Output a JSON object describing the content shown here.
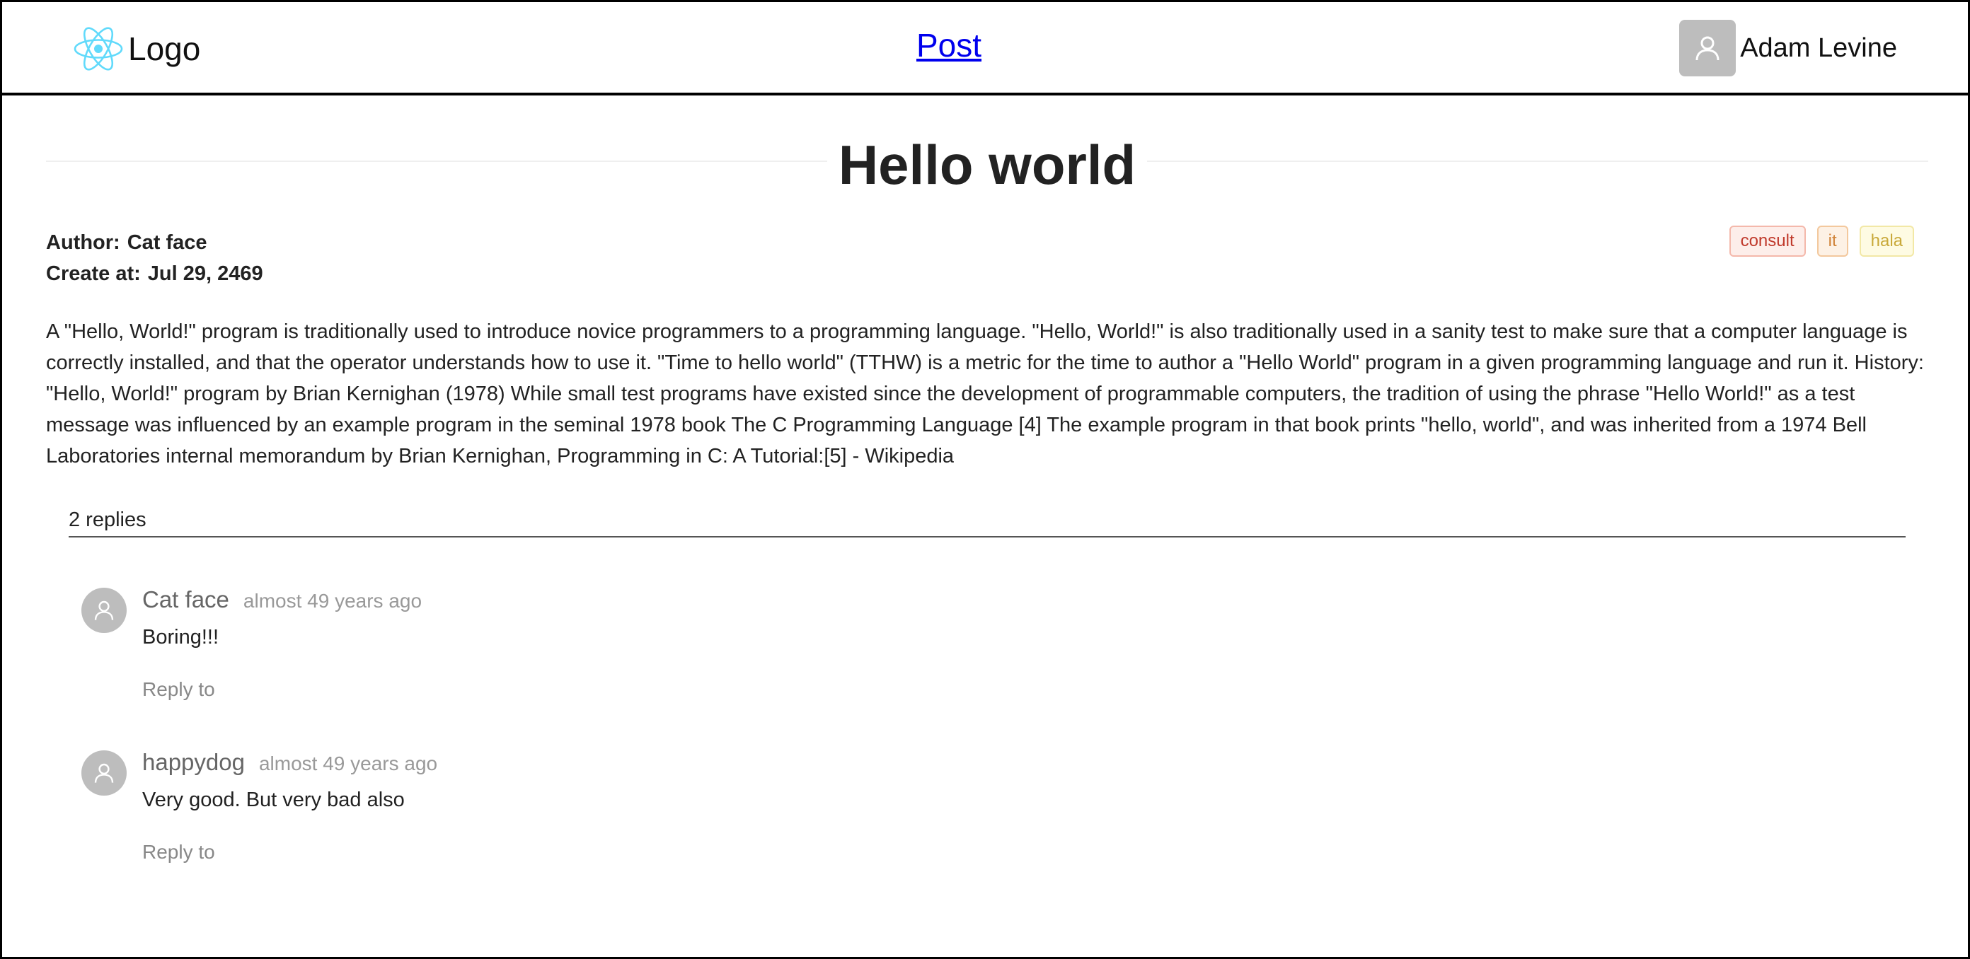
{
  "header": {
    "logo_text": "Logo",
    "nav_link": "Post",
    "user_name": "Adam Levine",
    "logo_color": "#61dafb"
  },
  "post": {
    "title": "Hello world",
    "author_label": "Author:",
    "author": "Cat face",
    "created_label": "Create at:",
    "created": "Jul 29, 2469",
    "tags": [
      {
        "label": "consult",
        "color": "#c0392b"
      },
      {
        "label": "it",
        "color": "#d1843a"
      },
      {
        "label": "hala",
        "color": "#c9a93a"
      }
    ],
    "content": "A \"Hello, World!\" program is traditionally used to introduce novice programmers to a programming language. \"Hello, World!\" is also traditionally used in a sanity test to make sure that a computer language is correctly installed, and that the operator understands how to use it. \"Time to hello world\" (TTHW) is a metric for the time to author a \"Hello World\" program in a given programming language and run it. History: \"Hello, World!\" program by Brian Kernighan (1978) While small test programs have existed since the development of programmable computers, the tradition of using the phrase \"Hello World!\" as a test message was influenced by an example program in the seminal 1978 book The C Programming Language [4] The example program in that book prints \"hello, world\", and was inherited from a 1974 Bell Laboratories internal memorandum by Brian Kernighan, Programming in C: A Tutorial:[5] - Wikipedia"
  },
  "replies": {
    "count_label": "2 replies",
    "items": [
      {
        "author": "Cat face",
        "time": "almost 49 years ago",
        "text": "Boring!!!",
        "reply_label": "Reply to"
      },
      {
        "author": "happydog",
        "time": "almost 49 years ago",
        "text": "Very good. But very bad also",
        "reply_label": "Reply to"
      }
    ]
  }
}
